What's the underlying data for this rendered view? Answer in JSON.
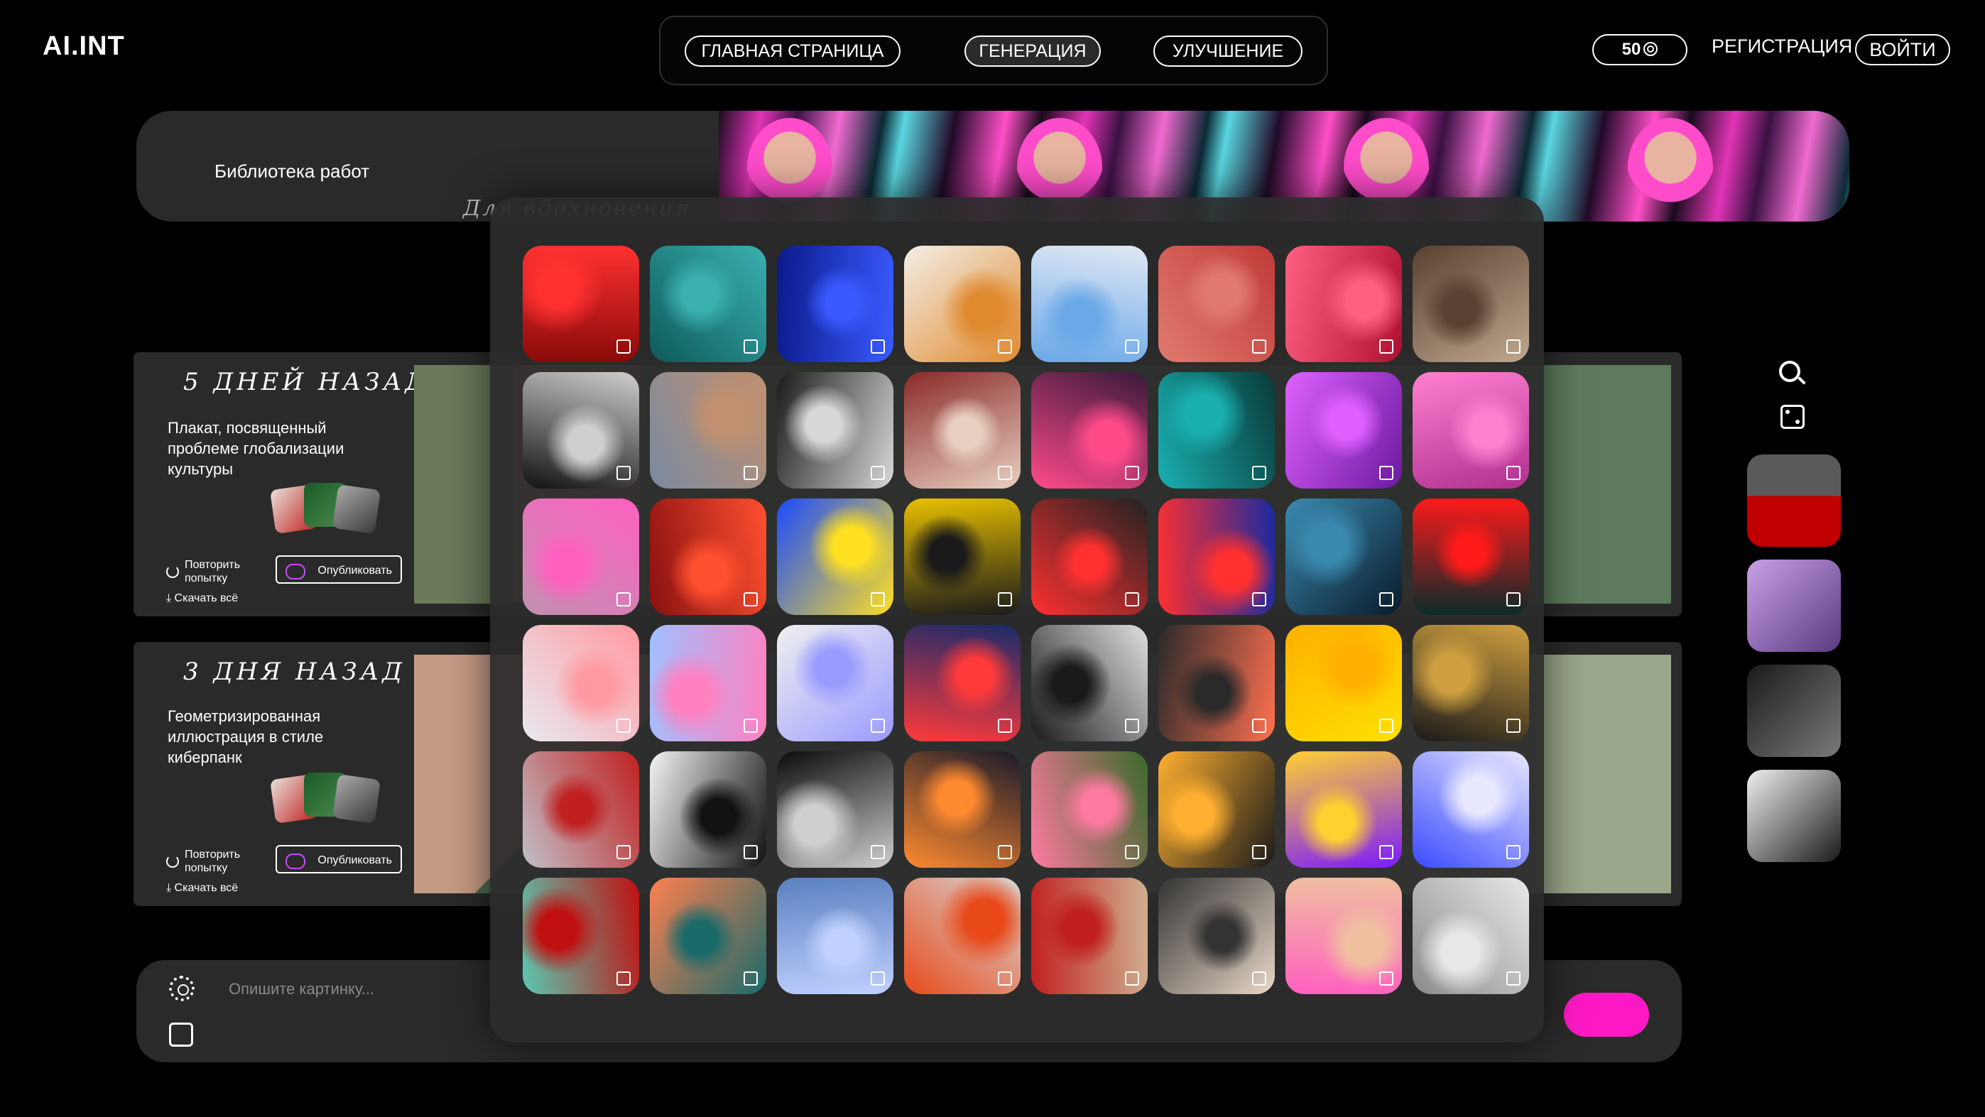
{
  "app": {
    "logo": "AI.INT",
    "nav": [
      {
        "label": "ГЛАВНАЯ СТРАНИЦА"
      },
      {
        "label": "ГЕНЕРАЦИЯ"
      },
      {
        "label": "УЛУЧШЕНИЕ"
      }
    ],
    "active_nav": "ГЕНЕРАЦИЯ",
    "credits": "50",
    "register": "РЕГИСТРАЦИЯ",
    "login": "ВОЙТИ"
  },
  "banner": {
    "title": "Библиотека работ",
    "overlay_text": "Для вдохновения"
  },
  "history": [
    {
      "date": "5 ДНЕЙ НАЗАД",
      "description": "Плакат, посвященный проблеме глобализации культуры",
      "retry": "Повторить попытку",
      "publish": "Опубликовать",
      "download": "Скачать всё"
    },
    {
      "date": "3 ДНЯ НАЗАД",
      "description": "Геометризированная иллюстрация в стиле киберпанк",
      "retry": "Повторить попытку",
      "publish": "Опубликовать",
      "download": "Скачать всё"
    }
  ],
  "prompt": {
    "placeholder": "Опишите картинку..."
  },
  "colors": {
    "accent": "#ff19c6",
    "panel": "#2a2a2a",
    "background": "#000000"
  },
  "sidebar": {
    "icons": [
      "search-icon",
      "dice-icon"
    ],
    "thumbs": [
      {
        "palette": [
          "#c00000",
          "#3a3a3a"
        ]
      },
      {
        "palette": [
          "#b080e0",
          "#5a3a80"
        ]
      },
      {
        "palette": [
          "#2a2a2a",
          "#6a6a6a"
        ]
      },
      {
        "palette": [
          "#eeeeee",
          "#222222"
        ]
      }
    ]
  },
  "gallery": {
    "tiles": [
      [
        "#8a0a0a",
        "#ff3030"
      ],
      [
        "#0f5a5a",
        "#3ab0b0"
      ],
      [
        "#0a1a8a",
        "#3a5aff"
      ],
      [
        "#f3efe6",
        "#e08a30"
      ],
      [
        "#e0e8f4",
        "#6aa8e8"
      ],
      [
        "#c03a38",
        "#e07a70"
      ],
      [
        "#b01030",
        "#ff6080"
      ],
      [
        "#c0a890",
        "#5a4030"
      ],
      [
        "#111111",
        "#cfcfcf"
      ],
      [
        "#7a8aa0",
        "#c09070"
      ],
      [
        "#1a1a1a",
        "#d8d8d8"
      ],
      [
        "#8a2a2a",
        "#e8d0c0"
      ],
      [
        "#3a1a3a",
        "#ff4a8a"
      ],
      [
        "#0a3a3a",
        "#1ab0b0"
      ],
      [
        "#6a1aa0",
        "#e060ff"
      ],
      [
        "#b03090",
        "#ff80d0"
      ],
      [
        "#c090b0",
        "#ff60c0"
      ],
      [
        "#8a1010",
        "#ff5030"
      ],
      [
        "#1a4aff",
        "#ffe020"
      ],
      [
        "#e8c000",
        "#1a1a1a"
      ],
      [
        "#222222",
        "#ff3030"
      ],
      [
        "#1a2aa0",
        "#ff3030"
      ],
      [
        "#0a1a2a",
        "#3a8ab0"
      ],
      [
        "#0a2a2a",
        "#ff1a1a"
      ],
      [
        "#e8e8f0",
        "#ff9aa0"
      ],
      [
        "#a0c0ff",
        "#ff80c0"
      ],
      [
        "#f0f0f0",
        "#9a9aff"
      ],
      [
        "#1a2a6a",
        "#ff3a3a"
      ],
      [
        "#e0e0e0",
        "#1a1a1a"
      ],
      [
        "#ff7050",
        "#2a2a2a"
      ],
      [
        "#ffe000",
        "#ffb000"
      ],
      [
        "#1a1a1a",
        "#d0a040"
      ],
      [
        "#c0c0c8",
        "#c02020"
      ],
      [
        "#f4f4f4",
        "#111111"
      ],
      [
        "#0a0a0a",
        "#cfcfcf"
      ],
      [
        "#1a1a2a",
        "#ff8a30"
      ],
      [
        "#3a6a2a",
        "#ff7aa0"
      ],
      [
        "#1a1a1a",
        "#ffb030"
      ],
      [
        "#7a1aff",
        "#ffd030"
      ],
      [
        "#3a4aff",
        "#e8e8ff"
      ],
      [
        "#5ac8b0",
        "#c01010"
      ],
      [
        "#ff8050",
        "#1a6a6a"
      ],
      [
        "#5a80c0",
        "#c0d0ff"
      ],
      [
        "#d8d8d8",
        "#e84a1a"
      ],
      [
        "#d0b090",
        "#c02020"
      ],
      [
        "#e8d8c8",
        "#333333"
      ],
      [
        "#ff60c0",
        "#f0c0a0"
      ],
      [
        "#8a8a8a",
        "#e8e8e8"
      ]
    ]
  }
}
